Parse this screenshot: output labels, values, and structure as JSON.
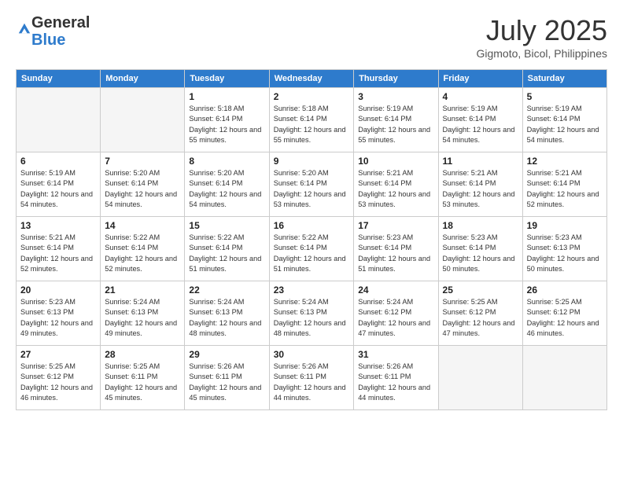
{
  "logo": {
    "general": "General",
    "blue": "Blue"
  },
  "header": {
    "month": "July 2025",
    "location": "Gigmoto, Bicol, Philippines"
  },
  "days_of_week": [
    "Sunday",
    "Monday",
    "Tuesday",
    "Wednesday",
    "Thursday",
    "Friday",
    "Saturday"
  ],
  "weeks": [
    [
      {
        "day": "",
        "sunrise": "",
        "sunset": "",
        "daylight": ""
      },
      {
        "day": "",
        "sunrise": "",
        "sunset": "",
        "daylight": ""
      },
      {
        "day": "1",
        "sunrise": "Sunrise: 5:18 AM",
        "sunset": "Sunset: 6:14 PM",
        "daylight": "Daylight: 12 hours and 55 minutes."
      },
      {
        "day": "2",
        "sunrise": "Sunrise: 5:18 AM",
        "sunset": "Sunset: 6:14 PM",
        "daylight": "Daylight: 12 hours and 55 minutes."
      },
      {
        "day": "3",
        "sunrise": "Sunrise: 5:19 AM",
        "sunset": "Sunset: 6:14 PM",
        "daylight": "Daylight: 12 hours and 55 minutes."
      },
      {
        "day": "4",
        "sunrise": "Sunrise: 5:19 AM",
        "sunset": "Sunset: 6:14 PM",
        "daylight": "Daylight: 12 hours and 54 minutes."
      },
      {
        "day": "5",
        "sunrise": "Sunrise: 5:19 AM",
        "sunset": "Sunset: 6:14 PM",
        "daylight": "Daylight: 12 hours and 54 minutes."
      }
    ],
    [
      {
        "day": "6",
        "sunrise": "Sunrise: 5:19 AM",
        "sunset": "Sunset: 6:14 PM",
        "daylight": "Daylight: 12 hours and 54 minutes."
      },
      {
        "day": "7",
        "sunrise": "Sunrise: 5:20 AM",
        "sunset": "Sunset: 6:14 PM",
        "daylight": "Daylight: 12 hours and 54 minutes."
      },
      {
        "day": "8",
        "sunrise": "Sunrise: 5:20 AM",
        "sunset": "Sunset: 6:14 PM",
        "daylight": "Daylight: 12 hours and 54 minutes."
      },
      {
        "day": "9",
        "sunrise": "Sunrise: 5:20 AM",
        "sunset": "Sunset: 6:14 PM",
        "daylight": "Daylight: 12 hours and 53 minutes."
      },
      {
        "day": "10",
        "sunrise": "Sunrise: 5:21 AM",
        "sunset": "Sunset: 6:14 PM",
        "daylight": "Daylight: 12 hours and 53 minutes."
      },
      {
        "day": "11",
        "sunrise": "Sunrise: 5:21 AM",
        "sunset": "Sunset: 6:14 PM",
        "daylight": "Daylight: 12 hours and 53 minutes."
      },
      {
        "day": "12",
        "sunrise": "Sunrise: 5:21 AM",
        "sunset": "Sunset: 6:14 PM",
        "daylight": "Daylight: 12 hours and 52 minutes."
      }
    ],
    [
      {
        "day": "13",
        "sunrise": "Sunrise: 5:21 AM",
        "sunset": "Sunset: 6:14 PM",
        "daylight": "Daylight: 12 hours and 52 minutes."
      },
      {
        "day": "14",
        "sunrise": "Sunrise: 5:22 AM",
        "sunset": "Sunset: 6:14 PM",
        "daylight": "Daylight: 12 hours and 52 minutes."
      },
      {
        "day": "15",
        "sunrise": "Sunrise: 5:22 AM",
        "sunset": "Sunset: 6:14 PM",
        "daylight": "Daylight: 12 hours and 51 minutes."
      },
      {
        "day": "16",
        "sunrise": "Sunrise: 5:22 AM",
        "sunset": "Sunset: 6:14 PM",
        "daylight": "Daylight: 12 hours and 51 minutes."
      },
      {
        "day": "17",
        "sunrise": "Sunrise: 5:23 AM",
        "sunset": "Sunset: 6:14 PM",
        "daylight": "Daylight: 12 hours and 51 minutes."
      },
      {
        "day": "18",
        "sunrise": "Sunrise: 5:23 AM",
        "sunset": "Sunset: 6:14 PM",
        "daylight": "Daylight: 12 hours and 50 minutes."
      },
      {
        "day": "19",
        "sunrise": "Sunrise: 5:23 AM",
        "sunset": "Sunset: 6:13 PM",
        "daylight": "Daylight: 12 hours and 50 minutes."
      }
    ],
    [
      {
        "day": "20",
        "sunrise": "Sunrise: 5:23 AM",
        "sunset": "Sunset: 6:13 PM",
        "daylight": "Daylight: 12 hours and 49 minutes."
      },
      {
        "day": "21",
        "sunrise": "Sunrise: 5:24 AM",
        "sunset": "Sunset: 6:13 PM",
        "daylight": "Daylight: 12 hours and 49 minutes."
      },
      {
        "day": "22",
        "sunrise": "Sunrise: 5:24 AM",
        "sunset": "Sunset: 6:13 PM",
        "daylight": "Daylight: 12 hours and 48 minutes."
      },
      {
        "day": "23",
        "sunrise": "Sunrise: 5:24 AM",
        "sunset": "Sunset: 6:13 PM",
        "daylight": "Daylight: 12 hours and 48 minutes."
      },
      {
        "day": "24",
        "sunrise": "Sunrise: 5:24 AM",
        "sunset": "Sunset: 6:12 PM",
        "daylight": "Daylight: 12 hours and 47 minutes."
      },
      {
        "day": "25",
        "sunrise": "Sunrise: 5:25 AM",
        "sunset": "Sunset: 6:12 PM",
        "daylight": "Daylight: 12 hours and 47 minutes."
      },
      {
        "day": "26",
        "sunrise": "Sunrise: 5:25 AM",
        "sunset": "Sunset: 6:12 PM",
        "daylight": "Daylight: 12 hours and 46 minutes."
      }
    ],
    [
      {
        "day": "27",
        "sunrise": "Sunrise: 5:25 AM",
        "sunset": "Sunset: 6:12 PM",
        "daylight": "Daylight: 12 hours and 46 minutes."
      },
      {
        "day": "28",
        "sunrise": "Sunrise: 5:25 AM",
        "sunset": "Sunset: 6:11 PM",
        "daylight": "Daylight: 12 hours and 45 minutes."
      },
      {
        "day": "29",
        "sunrise": "Sunrise: 5:26 AM",
        "sunset": "Sunset: 6:11 PM",
        "daylight": "Daylight: 12 hours and 45 minutes."
      },
      {
        "day": "30",
        "sunrise": "Sunrise: 5:26 AM",
        "sunset": "Sunset: 6:11 PM",
        "daylight": "Daylight: 12 hours and 44 minutes."
      },
      {
        "day": "31",
        "sunrise": "Sunrise: 5:26 AM",
        "sunset": "Sunset: 6:11 PM",
        "daylight": "Daylight: 12 hours and 44 minutes."
      },
      {
        "day": "",
        "sunrise": "",
        "sunset": "",
        "daylight": ""
      },
      {
        "day": "",
        "sunrise": "",
        "sunset": "",
        "daylight": ""
      }
    ]
  ]
}
